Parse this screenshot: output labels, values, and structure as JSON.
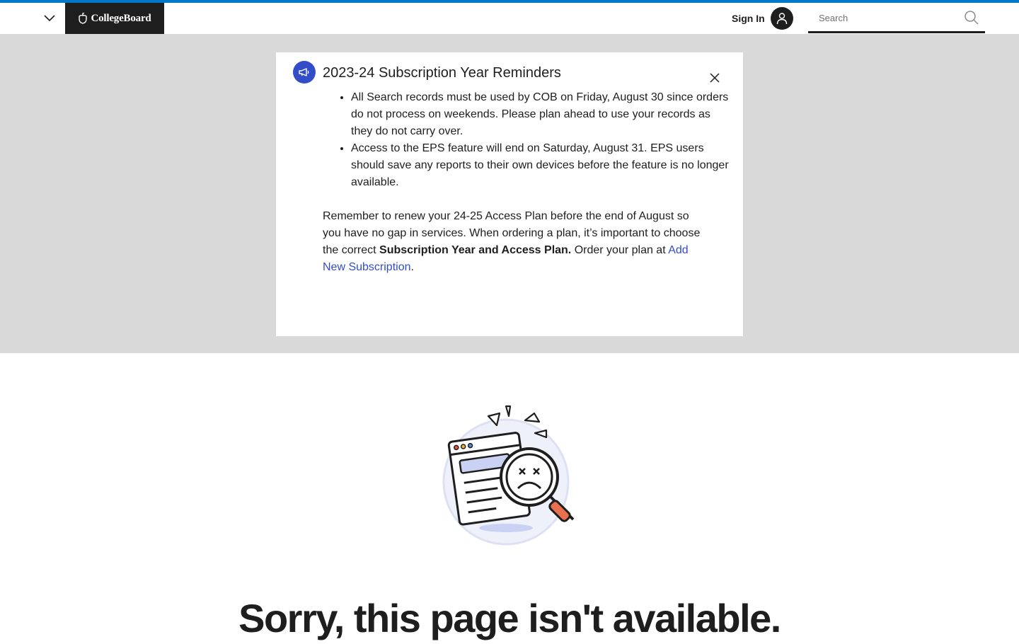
{
  "header": {
    "logo_text": "CollegeBoard",
    "signin_label": "Sign In",
    "search_placeholder": "Search",
    "accent_color": "#0077c8"
  },
  "notice": {
    "title": "2023-24 Subscription Year Reminders",
    "bullets": [
      "All Search records must be used by COB on Friday, August 30 since orders do not process on weekends. Please plan ahead to use your records as they do not carry over.",
      "Access to the EPS feature will end on Saturday, August 31. EPS users should save any reports to their own devices before the feature is no longer available."
    ],
    "para_start": "Remember to renew your 24-25 Access Plan before the end of August so you have no gap in services. When ordering a plan, it’s important to choose the correct ",
    "para_bold": "Subscription Year and Access Plan.",
    "para_mid": " Order your plan at ",
    "para_link": "Add New Subscription",
    "para_end": ".",
    "icon": "megaphone-icon",
    "accent_color": "#324dc7"
  },
  "main": {
    "error_title": "Sorry, this page isn't available."
  }
}
